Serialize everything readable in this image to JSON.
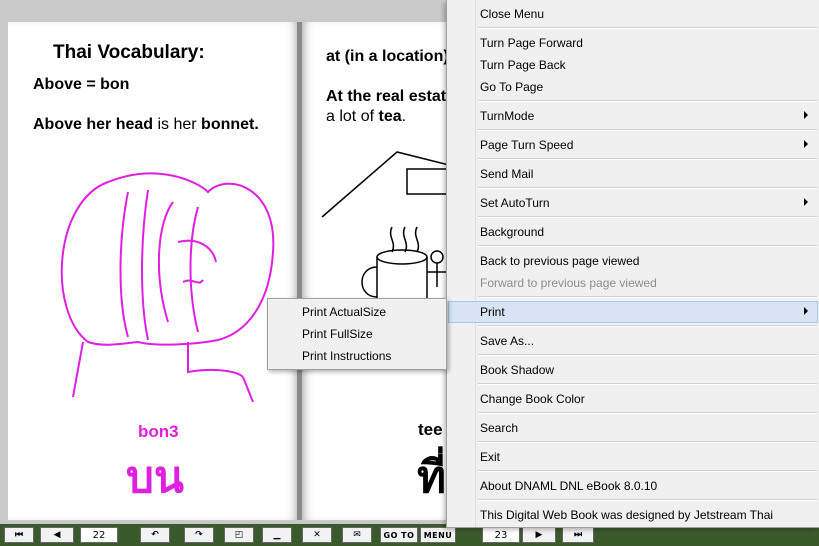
{
  "left_page": {
    "title": "Thai Vocabulary:",
    "line1": "Above = bon",
    "line2_a": "Above her head",
    "line2_b": " is her ",
    "line2_c": "bonnet.",
    "romanization": "bon3",
    "thai_word": "บน",
    "page_number": "22"
  },
  "right_page": {
    "line1": "at (in a location)",
    "line2": "At the real estat",
    "line3_a": "a lot of ",
    "line3_b": "tea",
    "line3_c": ".",
    "romanization": "tee",
    "thai_word": "ที่",
    "page_number": "23"
  },
  "toolbar": {
    "goto_label": "GO TO",
    "menu_label": "MENU"
  },
  "menu": {
    "items": [
      {
        "label": "Close Menu"
      },
      {
        "label": "Turn Page Forward"
      },
      {
        "label": "Turn Page Back"
      },
      {
        "label": "Go To Page"
      },
      {
        "label": "TurnMode"
      },
      {
        "label": "Page Turn Speed"
      },
      {
        "label": "Send Mail"
      },
      {
        "label": "Set AutoTurn"
      },
      {
        "label": "Background"
      },
      {
        "label": "Back to previous page viewed"
      },
      {
        "label": "Forward to previous page viewed"
      },
      {
        "label": "Print"
      },
      {
        "label": "Save As..."
      },
      {
        "label": "Book Shadow"
      },
      {
        "label": "Change Book Color"
      },
      {
        "label": "Search"
      },
      {
        "label": "Exit"
      },
      {
        "label": "About DNAML DNL eBook 8.0.10"
      },
      {
        "label": "This Digital Web Book was designed by Jetstream Thai"
      }
    ],
    "print_submenu": [
      {
        "label": "Print ActualSize"
      },
      {
        "label": "Print FullSize"
      },
      {
        "label": "Print Instructions"
      }
    ]
  },
  "colors": {
    "thai_pink": "#e020e0",
    "menu_bg": "#f0f0f0",
    "highlight": "#d7e4f3",
    "toolbar_bg": "#3b5a2c"
  }
}
